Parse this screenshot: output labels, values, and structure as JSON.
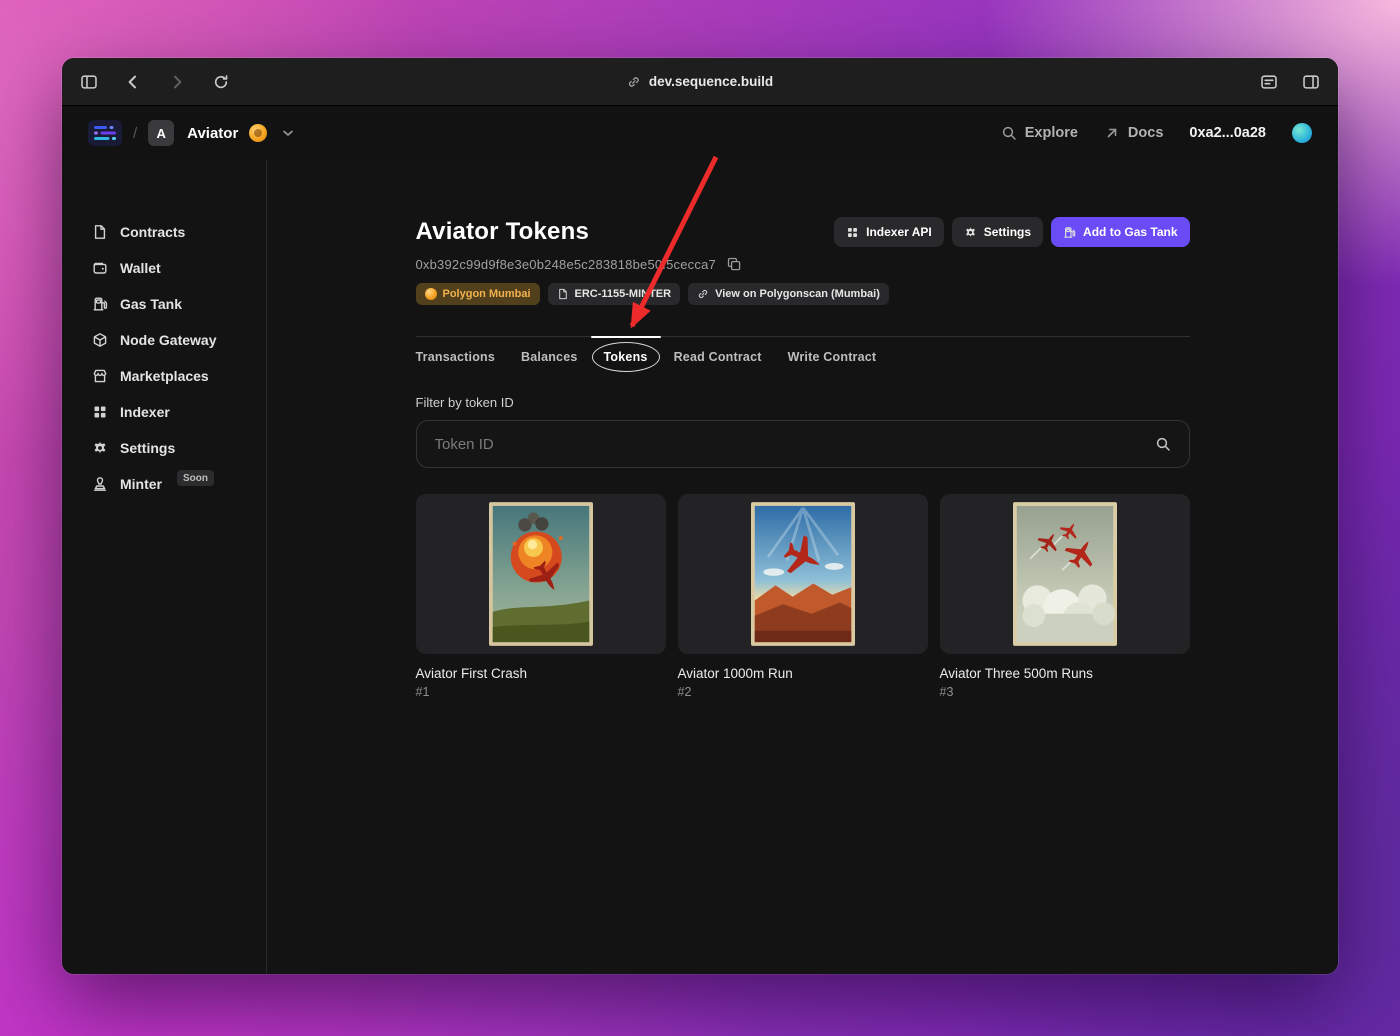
{
  "browser": {
    "url": "dev.sequence.build"
  },
  "header": {
    "breadcrumb_separator": "/",
    "project_initial": "A",
    "project_name": "Aviator",
    "explore_label": "Explore",
    "docs_label": "Docs",
    "wallet_address": "0xa2...0a28"
  },
  "sidebar": {
    "items": [
      {
        "label": "Contracts",
        "icon": "document-icon"
      },
      {
        "label": "Wallet",
        "icon": "wallet-icon"
      },
      {
        "label": "Gas Tank",
        "icon": "gas-pump-icon"
      },
      {
        "label": "Node Gateway",
        "icon": "cube-icon"
      },
      {
        "label": "Marketplaces",
        "icon": "storefront-icon"
      },
      {
        "label": "Indexer",
        "icon": "grid-icon"
      },
      {
        "label": "Settings",
        "icon": "gear-icon"
      },
      {
        "label": "Minter",
        "icon": "stamp-icon",
        "badge": "Soon"
      }
    ]
  },
  "main": {
    "title": "Aviator Tokens",
    "contract_address": "0xb392c99d9f8e3e0b248e5c283818be50f5cecca7",
    "actions": {
      "indexer_api": "Indexer API",
      "settings": "Settings",
      "add_to_gas_tank": "Add to Gas Tank"
    },
    "badges": {
      "network": "Polygon Mumbai",
      "standard": "ERC-1155-MINTER",
      "explorer": "View on Polygonscan (Mumbai)"
    },
    "tabs": [
      {
        "label": "Transactions",
        "active": false
      },
      {
        "label": "Balances",
        "active": false
      },
      {
        "label": "Tokens",
        "active": true
      },
      {
        "label": "Read Contract",
        "active": false
      },
      {
        "label": "Write Contract",
        "active": false
      }
    ],
    "filter_label": "Filter by token ID",
    "search_placeholder": "Token ID",
    "tokens": [
      {
        "name": "Aviator First Crash",
        "token_id": "#1"
      },
      {
        "name": "Aviator 1000m Run",
        "token_id": "#2"
      },
      {
        "name": "Aviator Three 500m Runs",
        "token_id": "#3"
      }
    ]
  },
  "icons": {
    "search": "magnifier",
    "docs": "arrow-up-right",
    "copy": "overlapping-squares",
    "link": "chain-link",
    "settings": "gear",
    "indexer": "grid",
    "gas": "gas-pump"
  },
  "colors": {
    "accent_purple": "#6a4cf6",
    "network_badge_bg": "#52401c",
    "network_badge_text": "#f2b14e",
    "annotation_red": "#ee2b2b"
  }
}
